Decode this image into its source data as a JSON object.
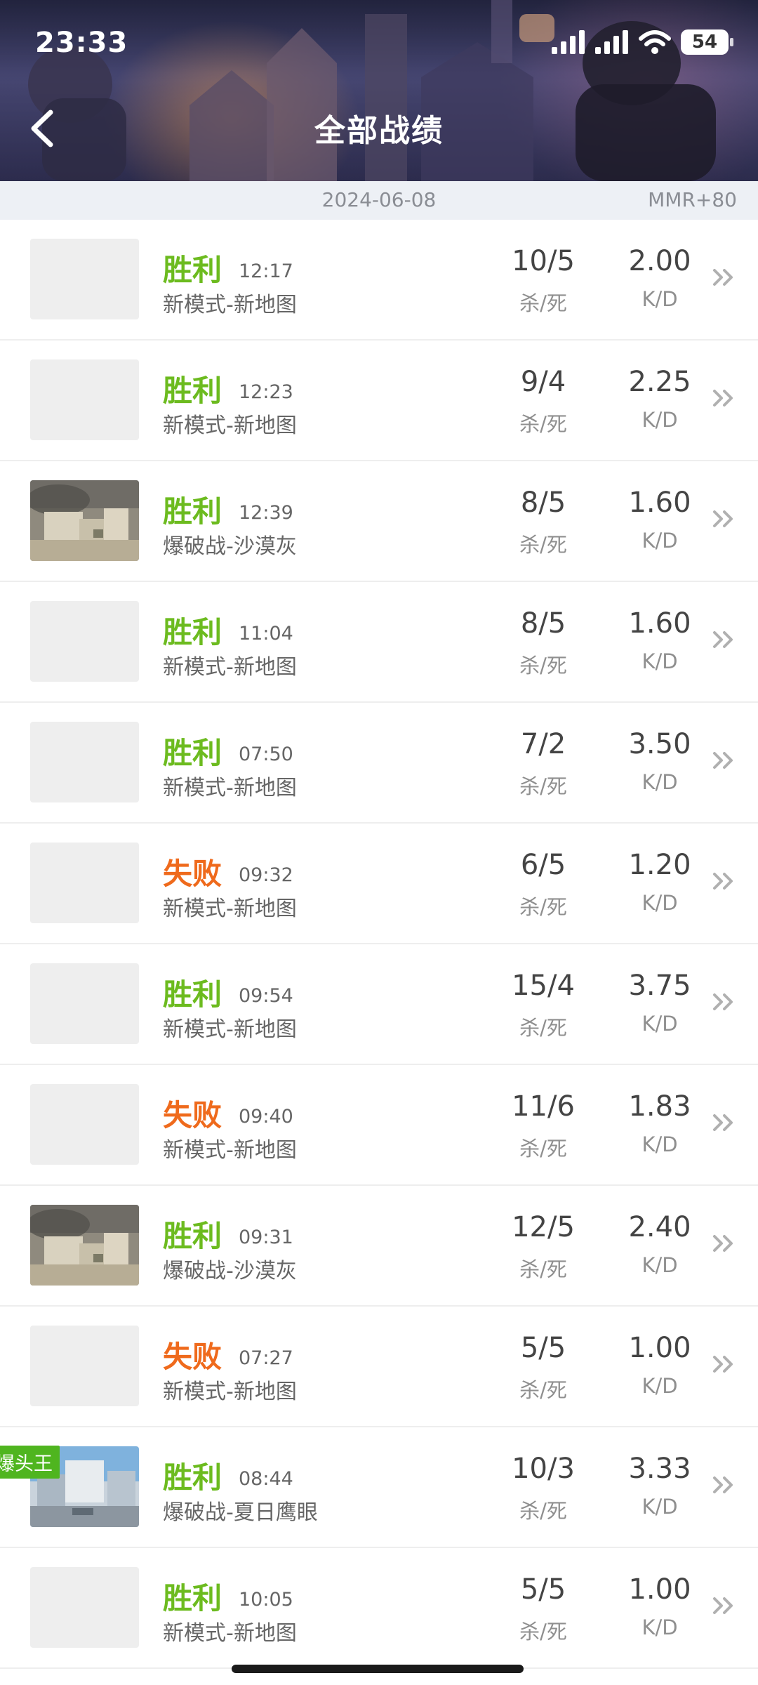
{
  "status_bar": {
    "time": "23:33",
    "battery": "54"
  },
  "header": {
    "title": "全部战绩"
  },
  "date_bar": {
    "date": "2024-06-08",
    "mmr": "MMR+80"
  },
  "labels": {
    "kill_death": "杀/死",
    "kd": "K/D"
  },
  "colors": {
    "win": "#6cbb1f",
    "lose": "#ef6a1c",
    "badge": "#4fb51f"
  },
  "matches": [
    {
      "result": "胜利",
      "outcome": "win",
      "time": "12:17",
      "mode": "新模式-新地图",
      "kills_deaths": "10/5",
      "kd": "2.00",
      "thumb": "placeholder"
    },
    {
      "result": "胜利",
      "outcome": "win",
      "time": "12:23",
      "mode": "新模式-新地图",
      "kills_deaths": "9/4",
      "kd": "2.25",
      "thumb": "placeholder"
    },
    {
      "result": "胜利",
      "outcome": "win",
      "time": "12:39",
      "mode": "爆破战-沙漠灰",
      "kills_deaths": "8/5",
      "kd": "1.60",
      "thumb": "desert-map"
    },
    {
      "result": "胜利",
      "outcome": "win",
      "time": "11:04",
      "mode": "新模式-新地图",
      "kills_deaths": "8/5",
      "kd": "1.60",
      "thumb": "placeholder"
    },
    {
      "result": "胜利",
      "outcome": "win",
      "time": "07:50",
      "mode": "新模式-新地图",
      "kills_deaths": "7/2",
      "kd": "3.50",
      "thumb": "placeholder"
    },
    {
      "result": "失败",
      "outcome": "lose",
      "time": "09:32",
      "mode": "新模式-新地图",
      "kills_deaths": "6/5",
      "kd": "1.20",
      "thumb": "placeholder"
    },
    {
      "result": "胜利",
      "outcome": "win",
      "time": "09:54",
      "mode": "新模式-新地图",
      "kills_deaths": "15/4",
      "kd": "3.75",
      "thumb": "placeholder"
    },
    {
      "result": "失败",
      "outcome": "lose",
      "time": "09:40",
      "mode": "新模式-新地图",
      "kills_deaths": "11/6",
      "kd": "1.83",
      "thumb": "placeholder"
    },
    {
      "result": "胜利",
      "outcome": "win",
      "time": "09:31",
      "mode": "爆破战-沙漠灰",
      "kills_deaths": "12/5",
      "kd": "2.40",
      "thumb": "desert-map"
    },
    {
      "result": "失败",
      "outcome": "lose",
      "time": "07:27",
      "mode": "新模式-新地图",
      "kills_deaths": "5/5",
      "kd": "1.00",
      "thumb": "placeholder"
    },
    {
      "result": "胜利",
      "outcome": "win",
      "time": "08:44",
      "mode": "爆破战-夏日鹰眼",
      "kills_deaths": "10/3",
      "kd": "3.33",
      "thumb": "summer-map",
      "badge": "爆头王"
    },
    {
      "result": "胜利",
      "outcome": "win",
      "time": "10:05",
      "mode": "新模式-新地图",
      "kills_deaths": "5/5",
      "kd": "1.00",
      "thumb": "placeholder"
    }
  ]
}
